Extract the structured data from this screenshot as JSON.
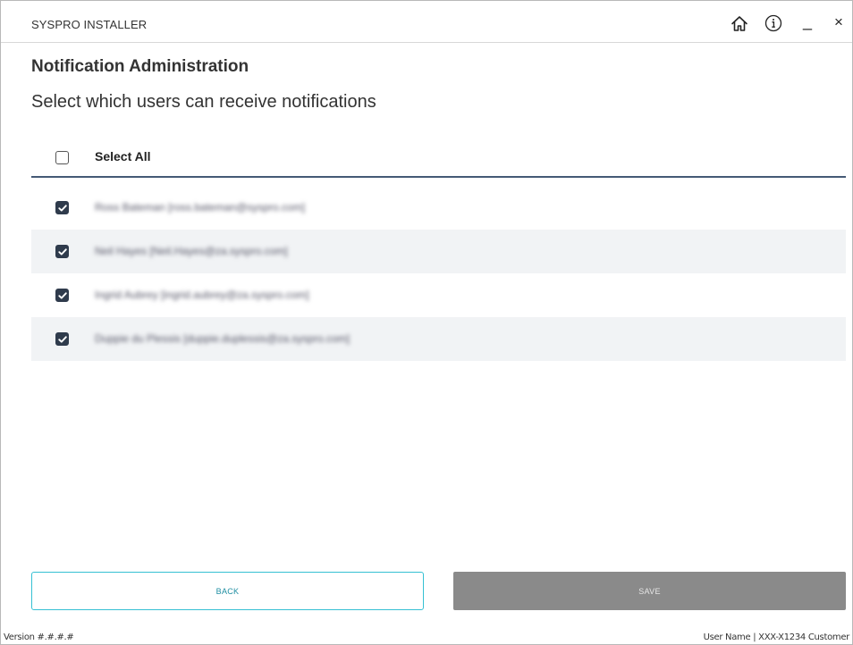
{
  "window": {
    "title": "SYSPRO INSTALLER",
    "icons": [
      "home-icon",
      "info-icon",
      "minimize-icon",
      "close-icon"
    ],
    "minimize_glyph": "_",
    "close_glyph": "×"
  },
  "page": {
    "title": "Notification Administration",
    "subtitle": "Select which users can receive notifications"
  },
  "select_all": {
    "label": "Select All",
    "checked": false
  },
  "users": [
    {
      "label": "Ross Bateman [ross.bateman@syspro.com]",
      "checked": true
    },
    {
      "label": "Neil Hayes [Neil.Hayes@za.syspro.com]",
      "checked": true
    },
    {
      "label": "Ingrid Aubrey [ingrid.aubrey@za.syspro.com]",
      "checked": true
    },
    {
      "label": "Duppie du Plessis [duppie.duplessis@za.syspro.com]",
      "checked": true
    }
  ],
  "buttons": {
    "back_label": "BACK",
    "save_label": "SAVE"
  },
  "footer": {
    "version": "Version #.#.#.#",
    "user_info": "User Name | XXX-X1234 Customer"
  },
  "colors": {
    "accent": "#35c0d3",
    "checkbox": "#2f3b4c",
    "divider": "#455a75",
    "save_disabled": "#8a8a8a",
    "row_alt": "#f1f3f5"
  }
}
